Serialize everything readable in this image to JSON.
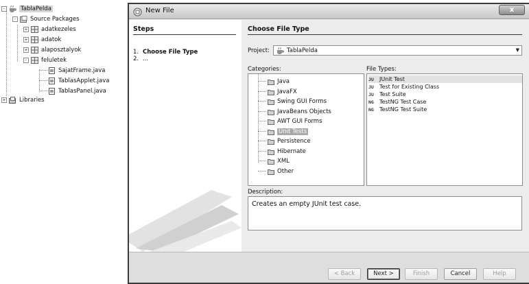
{
  "project_tree": {
    "project_name": "TablaPelda",
    "source_packages": "Source Packages",
    "packages": [
      "adatkezeles",
      "adatok",
      "alaposztalyok",
      "feluletek"
    ],
    "files": [
      "SajatFrame.java",
      "TablasApplet.java",
      "TablasPanel.java"
    ],
    "libraries": "Libraries"
  },
  "dialog": {
    "title": "New File",
    "close_glyph": "x",
    "steps": {
      "heading": "Steps",
      "items": [
        {
          "num": "1.",
          "label": "Choose File Type"
        },
        {
          "num": "2.",
          "label": "..."
        }
      ]
    },
    "main": {
      "heading": "Choose File Type",
      "project_label": "Project:",
      "project_value": "TablaPelda",
      "categories_label": "Categories:",
      "categories": [
        "Java",
        "JavaFX",
        "Swing GUI Forms",
        "JavaBeans Objects",
        "AWT GUI Forms",
        "Unit Tests",
        "Persistence",
        "Hibernate",
        "XML",
        "Other"
      ],
      "selected_category": "Unit Tests",
      "file_types_label": "File Types:",
      "file_types": [
        {
          "icon": "JU",
          "label": "JUnit Test"
        },
        {
          "icon": "JU",
          "label": "Test for Existing Class"
        },
        {
          "icon": "JU",
          "label": "Test Suite"
        },
        {
          "icon": "NG",
          "label": "TestNG Test Case"
        },
        {
          "icon": "NG",
          "label": "TestNG Test Suite"
        }
      ],
      "selected_file_type": "JUnit Test",
      "description_label": "Description:",
      "description": "Creates an empty JUnit test case."
    },
    "buttons": {
      "back": "< Back",
      "next": "Next >",
      "finish": "Finish",
      "cancel": "Cancel",
      "help": "Help"
    }
  }
}
